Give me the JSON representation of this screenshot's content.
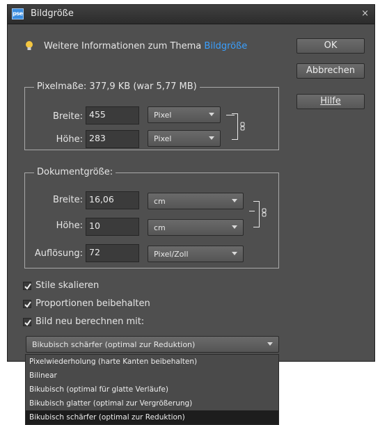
{
  "window": {
    "title": "Bildgröße",
    "app_icon_text": "pse",
    "close_glyph": "×"
  },
  "info": {
    "text": "Weitere Informationen zum Thema",
    "link": "Bildgröße",
    "icon": "lightbulb-icon"
  },
  "buttons": {
    "ok": "OK",
    "cancel": "Abbrechen",
    "help": "Hilfe"
  },
  "pixel_dimensions": {
    "legend": "Pixelmaße: 377,9 KB (war 5,77 MB)",
    "width_label": "Breite:",
    "width_value": "455",
    "width_unit": "Pixel",
    "height_label": "Höhe:",
    "height_value": "283",
    "height_unit": "Pixel"
  },
  "document_size": {
    "legend": "Dokumentgröße:",
    "width_label": "Breite:",
    "width_value": "16,06",
    "width_unit": "cm",
    "height_label": "Höhe:",
    "height_value": "10",
    "height_unit": "cm",
    "resolution_label": "Auflösung:",
    "resolution_value": "72",
    "resolution_unit": "Pixel/Zoll"
  },
  "checkboxes": {
    "scale_styles": {
      "label": "Stile skalieren",
      "checked": true
    },
    "constrain": {
      "label": "Proportionen beibehalten",
      "checked": true
    },
    "resample": {
      "label": "Bild neu berechnen mit:",
      "checked": true
    }
  },
  "resample_method": {
    "selected": "Bikubisch schärfer (optimal zur Reduktion)",
    "options": [
      "Pixelwiederholung (harte Kanten beibehalten)",
      "Bilinear",
      "Bikubisch (optimal für glatte Verläufe)",
      "Bikubisch glatter (optimal zur Vergrößerung)",
      "Bikubisch schärfer (optimal zur Reduktion)"
    ],
    "highlighted_index": 4
  },
  "colors": {
    "dialog_bg": "#4f4f4f",
    "link": "#3aa0ff",
    "selected_option": "#1d1d1d"
  }
}
